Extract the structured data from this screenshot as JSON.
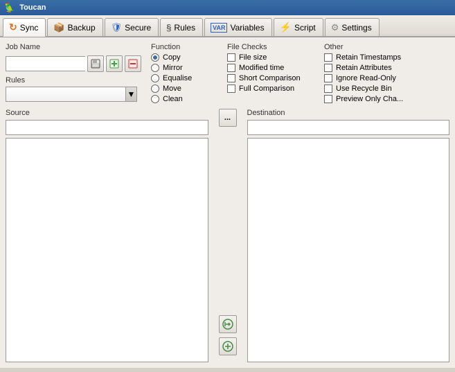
{
  "titleBar": {
    "icon": "🦜",
    "title": "Toucan"
  },
  "tabs": [
    {
      "id": "sync",
      "label": "Sync",
      "icon": "↻",
      "active": true
    },
    {
      "id": "backup",
      "label": "Backup",
      "icon": "📦"
    },
    {
      "id": "secure",
      "label": "Secure",
      "icon": "🔒"
    },
    {
      "id": "rules",
      "label": "Rules",
      "icon": "§"
    },
    {
      "id": "variables",
      "label": "Variables",
      "icon": "VAR"
    },
    {
      "id": "script",
      "label": "Script",
      "icon": "⚡"
    },
    {
      "id": "settings",
      "label": "Settings",
      "icon": "⚙"
    }
  ],
  "jobName": {
    "label": "Job Name",
    "value": "",
    "placeholder": ""
  },
  "rules": {
    "label": "Rules",
    "value": "",
    "placeholder": ""
  },
  "function": {
    "label": "Function",
    "options": [
      {
        "id": "copy",
        "label": "Copy",
        "selected": true
      },
      {
        "id": "mirror",
        "label": "Mirror",
        "selected": false
      },
      {
        "id": "equalise",
        "label": "Equalise",
        "selected": false
      },
      {
        "id": "move",
        "label": "Move",
        "selected": false
      },
      {
        "id": "clean",
        "label": "Clean",
        "selected": false
      }
    ]
  },
  "fileChecks": {
    "label": "File Checks",
    "options": [
      {
        "id": "file-size",
        "label": "File size",
        "checked": false
      },
      {
        "id": "modified-time",
        "label": "Modified time",
        "checked": false
      },
      {
        "id": "short-comparison",
        "label": "Short Comparison",
        "checked": false
      },
      {
        "id": "full-comparison",
        "label": "Full Comparison",
        "checked": false
      }
    ]
  },
  "other": {
    "label": "Other",
    "options": [
      {
        "id": "retain-timestamps",
        "label": "Retain Timestamps",
        "checked": false
      },
      {
        "id": "retain-attributes",
        "label": "Retain Attributes",
        "checked": false
      },
      {
        "id": "ignore-read-only",
        "label": "Ignore Read-Only",
        "checked": false
      },
      {
        "id": "use-recycle-bin",
        "label": "Use Recycle Bin",
        "checked": false
      },
      {
        "id": "preview-only-changes",
        "label": "Preview Only Cha...",
        "checked": false
      }
    ]
  },
  "source": {
    "label": "Source",
    "path": ""
  },
  "destination": {
    "label": "Destination",
    "path": ""
  },
  "buttons": {
    "browse": "...",
    "transferRight": "→",
    "transferPlus": "+"
  }
}
